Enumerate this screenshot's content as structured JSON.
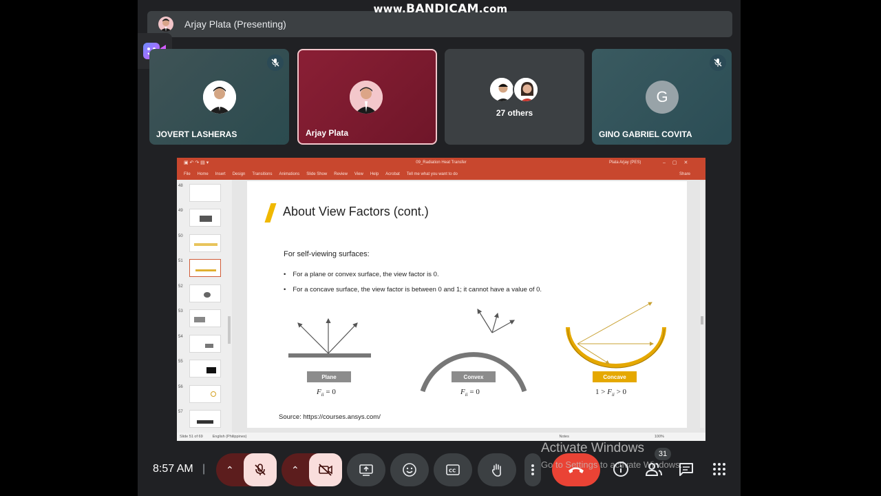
{
  "watermark": {
    "prefix": "www.",
    "brand": "BANDICAM",
    "suffix": ".com"
  },
  "presenter": {
    "name": "Arjay Plata (Presenting)"
  },
  "tiles": [
    {
      "name": "JOVERT LASHERAS",
      "muted": true
    },
    {
      "name": "Arjay Plata",
      "muted": false
    },
    {
      "name": "27 others"
    },
    {
      "name": "GINO GABRIEL COVITA",
      "initial": "G",
      "muted": true
    }
  ],
  "ppt": {
    "window_title": "09_Radiation Heat Transfer",
    "user": "Plata Arjay (PES)",
    "ribbon": [
      "File",
      "Home",
      "Insert",
      "Design",
      "Transitions",
      "Animations",
      "Slide Show",
      "Review",
      "View",
      "Help",
      "Acrobat",
      "Tell me what you want to do"
    ],
    "share": "Share",
    "thumbs": [
      "48",
      "49",
      "50",
      "51",
      "52",
      "53",
      "54",
      "55",
      "56",
      "57"
    ],
    "selected_thumb": "51",
    "status_left": "Slide 51 of 69",
    "status_lang": "English (Philippines)",
    "status_notes": "Notes",
    "zoom": "100%"
  },
  "slide": {
    "title": "About View Factors (cont.)",
    "subtitle": "For self-viewing surfaces:",
    "bullets": [
      "For a plane or convex surface, the view factor is 0.",
      "For a concave surface, the view factor is between 0 and 1; it cannot have a value of 0."
    ],
    "labels": {
      "plane": "Plane",
      "convex": "Convex",
      "concave": "Concave"
    },
    "formulas": {
      "plane": "F_ii = 0",
      "convex": "F_ii = 0",
      "concave": "1 > F_ii > 0"
    },
    "source": "Source: https://courses.ansys.com/"
  },
  "bottom": {
    "time": "8:57 AM",
    "participants_count": "31"
  },
  "overlay": {
    "activate": "Activate Windows",
    "settings": "Go to Settings to activate Windows."
  },
  "colors": {
    "end_call": "#ea4335",
    "muted_btn": "#f9dedc",
    "accent_orange": "#c8472e",
    "concave_gold": "#e5a800"
  }
}
